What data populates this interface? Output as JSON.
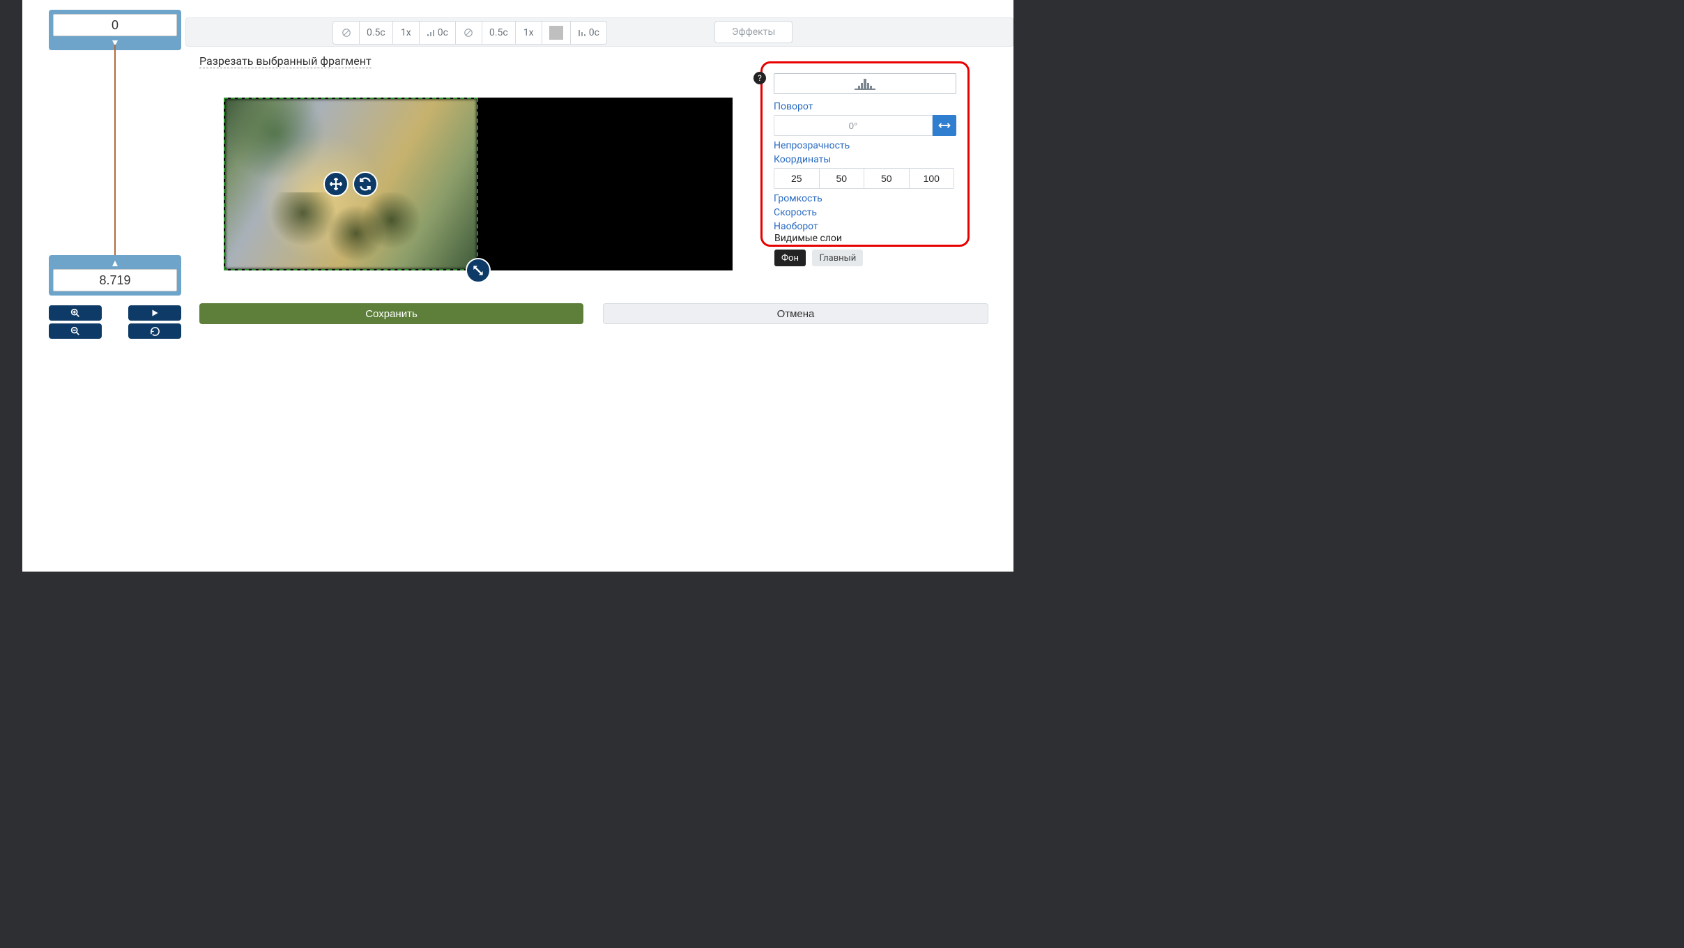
{
  "timeline": {
    "start_value": "0",
    "end_value": "8.719"
  },
  "toolbar": {
    "items_left": [
      "0.5с",
      "1x",
      "0с"
    ],
    "items_right": [
      "0.5с",
      "1x"
    ],
    "fade_out": "0с",
    "effects_label": "Эффекты"
  },
  "cut_link": "Разрезать выбранный фрагмент",
  "props": {
    "rotation_label": "Поворот",
    "rotation_value": "0°",
    "opacity_label": "Непрозрачность",
    "coords_label": "Координаты",
    "coords": [
      "25",
      "50",
      "50",
      "100"
    ],
    "volume_label": "Громкость",
    "speed_label": "Скорость",
    "reverse_label": "Наоборот"
  },
  "layers": {
    "title": "Видимые слои",
    "bg": "Фон",
    "main": "Главный"
  },
  "actions": {
    "save": "Сохранить",
    "cancel": "Отмена"
  },
  "icons": {
    "help": "?"
  }
}
